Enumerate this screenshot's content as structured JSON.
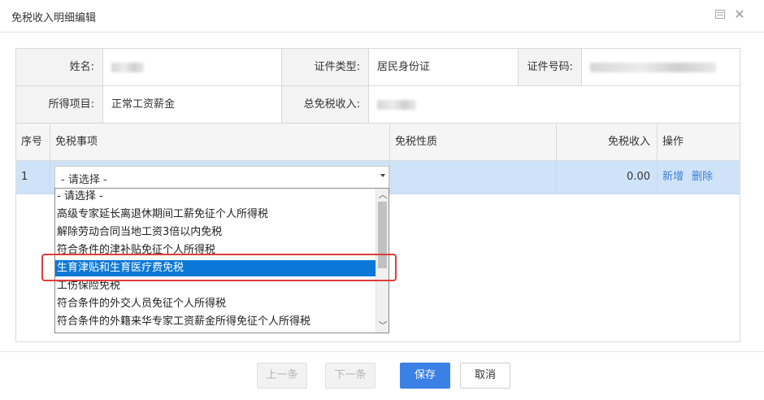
{
  "dialog": {
    "title": "免税收入明细编辑"
  },
  "info": {
    "name_label": "姓名:",
    "name_value": "",
    "id_type_label": "证件类型:",
    "id_type_value": "居民身份证",
    "id_number_label": "证件号码:",
    "id_number_value": "",
    "income_item_label": "所得项目:",
    "income_item_value": "正常工资薪金",
    "total_exempt_label": "总免税收入:",
    "total_exempt_value": ""
  },
  "table": {
    "headers": [
      "序号",
      "免税事项",
      "免税性质",
      "免税收入",
      "操作"
    ],
    "rows": [
      {
        "index": "1",
        "item": "- 请选择 -",
        "nature": "",
        "amount": "0.00",
        "actions": [
          "新增",
          "删除"
        ]
      }
    ]
  },
  "dropdown": {
    "options": [
      "- 请选择 -",
      "高级专家延长离退休期间工薪免征个人所得税",
      "解除劳动合同当地工资3倍以内免税",
      "符合条件的津补贴免征个人所得税",
      "生育津贴和生育医疗费免税",
      "工伤保险免税",
      "符合条件的外交人员免征个人所得税",
      "符合条件的外籍来华专家工资薪金所得免征个人所得税"
    ],
    "selected_index": 4
  },
  "footer": {
    "prev": "上一条",
    "next": "下一条",
    "save": "保存",
    "cancel": "取消"
  },
  "colors": {
    "primary": "#3b80e5",
    "selected_row": "#cfe3f8",
    "highlight_border": "#e03c3c",
    "link": "#3c7fd6"
  }
}
